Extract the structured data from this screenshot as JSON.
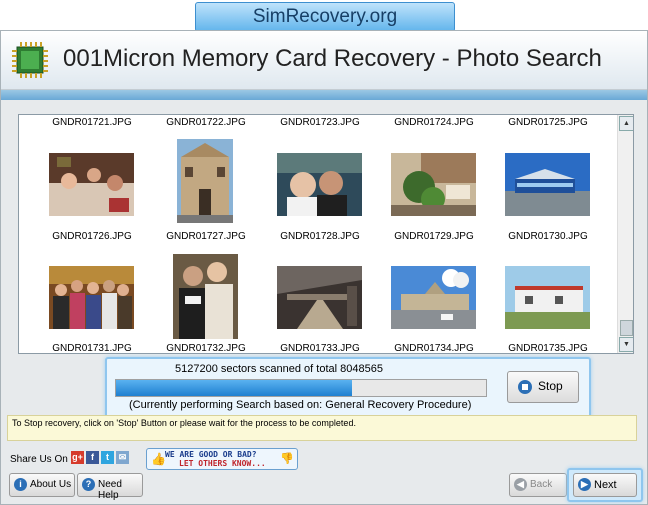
{
  "banner": {
    "text": "SimRecovery.org"
  },
  "app": {
    "title": "001Micron Memory Card Recovery - Photo Search"
  },
  "gallery": {
    "top_row_captions": [
      "GNDR01721.JPG",
      "GNDR01722.JPG",
      "GNDR01723.JPG",
      "GNDR01724.JPG",
      "GNDR01725.JPG"
    ],
    "middle_row_captions": [
      "GNDR01726.JPG",
      "GNDR01727.JPG",
      "GNDR01728.JPG",
      "GNDR01729.JPG",
      "GNDR01730.JPG"
    ],
    "bottom_row_captions": [
      "GNDR01731.JPG",
      "GNDR01732.JPG",
      "GNDR01733.JPG",
      "GNDR01734.JPG",
      "GNDR01735.JPG"
    ]
  },
  "progress": {
    "scan_text": "5127200 sectors scanned of total 8048565",
    "fraction": 0.637,
    "procedure_text": "(Currently performing Search based on:  General Recovery Procedure)",
    "stop_label": "Stop"
  },
  "info": {
    "text": "To Stop recovery, click on 'Stop' Button or please wait for the process to be completed."
  },
  "share": {
    "label": "Share Us On :",
    "line1": "WE ARE GOOD OR BAD?",
    "line2": "LET OTHERS KNOW..."
  },
  "buttons": {
    "about": "About Us",
    "help": "Need Help",
    "back": "Back",
    "next": "Next"
  }
}
